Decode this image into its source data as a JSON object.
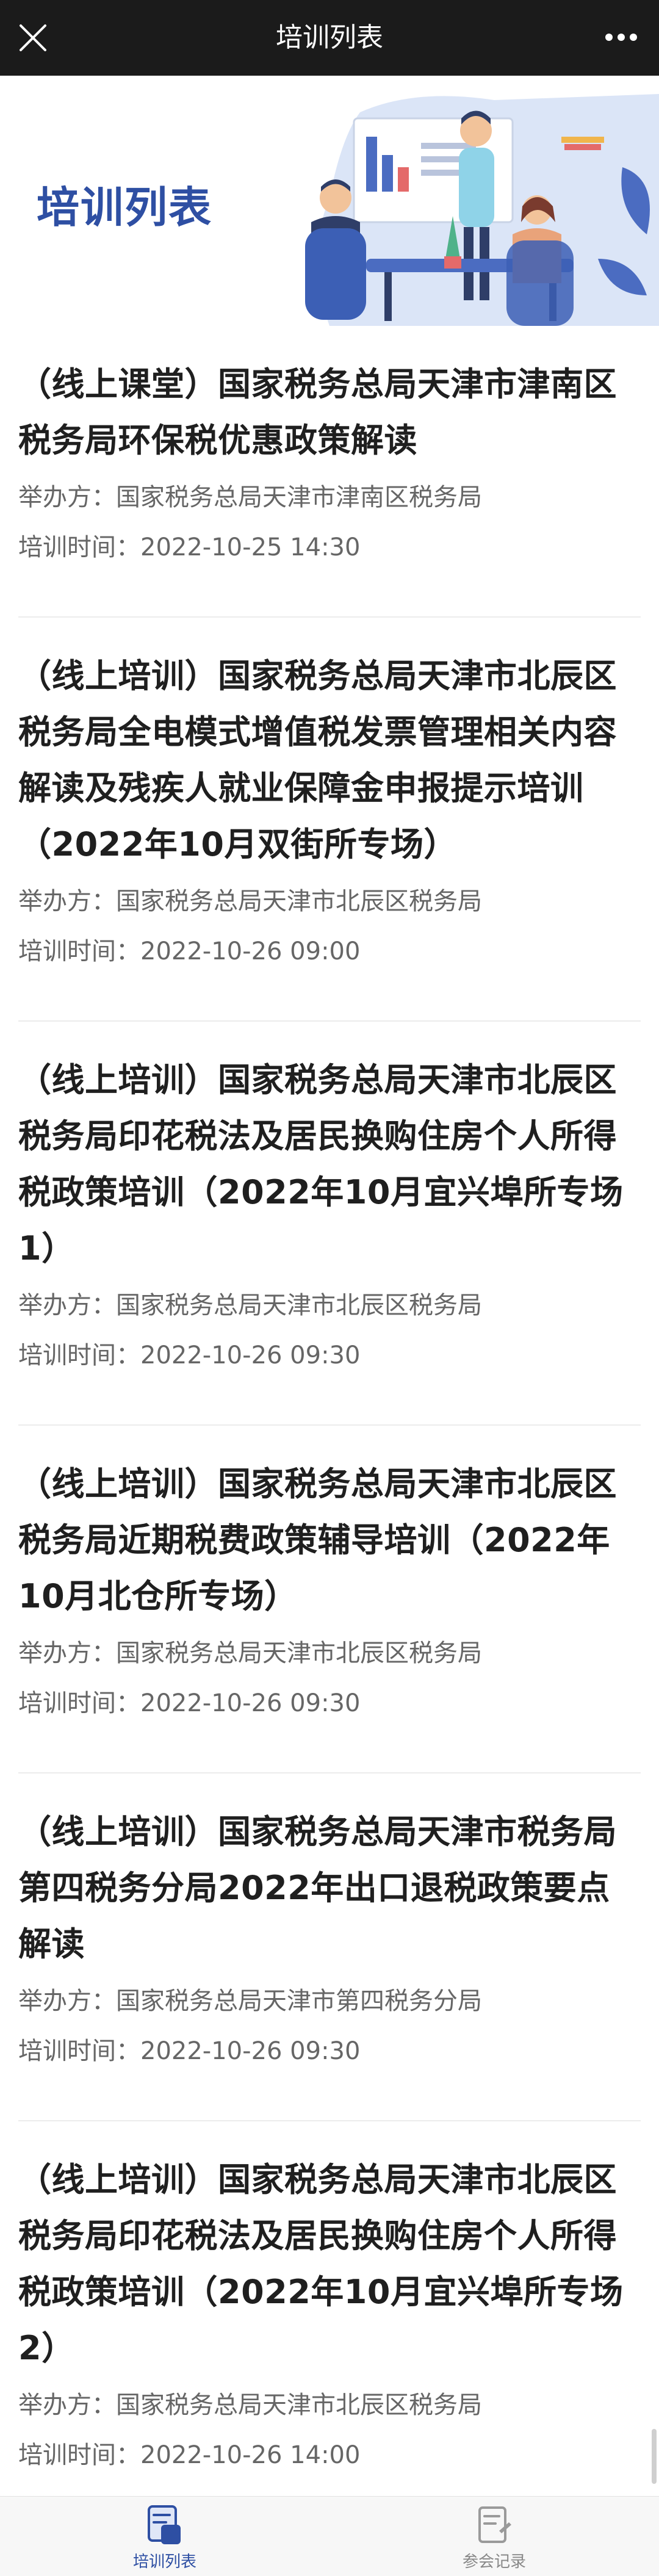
{
  "header": {
    "title": "培训列表"
  },
  "banner": {
    "title": "培训列表"
  },
  "list": {
    "organizer_label": "举办方：",
    "time_label": "培训时间：",
    "items": [
      {
        "title": "（线上课堂）国家税务总局天津市津南区税务局环保税优惠政策解读",
        "organizer": "国家税务总局天津市津南区税务局",
        "time": "2022-10-25 14:30"
      },
      {
        "title": "（线上培训）国家税务总局天津市北辰区税务局全电模式增值税发票管理相关内容解读及残疾人就业保障金申报提示培训（2022年10月双街所专场）",
        "organizer": "国家税务总局天津市北辰区税务局",
        "time": "2022-10-26 09:00"
      },
      {
        "title": "（线上培训）国家税务总局天津市北辰区税务局印花税法及居民换购住房个人所得税政策培训（2022年10月宜兴埠所专场1）",
        "organizer": "国家税务总局天津市北辰区税务局",
        "time": "2022-10-26 09:30"
      },
      {
        "title": "（线上培训）国家税务总局天津市北辰区税务局近期税费政策辅导培训（2022年10月北仓所专场）",
        "organizer": "国家税务总局天津市北辰区税务局",
        "time": "2022-10-26 09:30"
      },
      {
        "title": "（线上培训）国家税务总局天津市税务局第四税务分局2022年出口退税政策要点解读",
        "organizer": "国家税务总局天津市第四税务分局",
        "time": "2022-10-26 09:30"
      },
      {
        "title": "（线上培训）国家税务总局天津市北辰区税务局印花税法及居民换购住房个人所得税政策培训（2022年10月宜兴埠所专场2）",
        "organizer": "国家税务总局天津市北辰区税务局",
        "time": "2022-10-26 14:00"
      }
    ]
  },
  "tabbar": {
    "tabs": [
      {
        "label": "培训列表",
        "icon": "training-list-icon",
        "active": true
      },
      {
        "label": "参会记录",
        "icon": "attendance-record-icon",
        "active": false
      }
    ]
  },
  "colors": {
    "accent": "#2e4fa3",
    "topbar": "#1b1b1b",
    "meta_text": "#666666"
  }
}
